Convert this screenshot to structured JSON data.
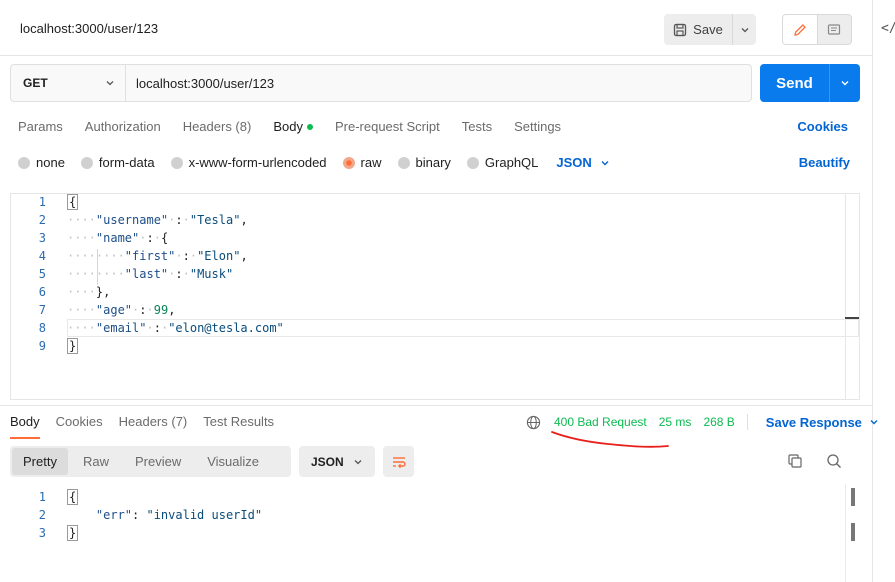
{
  "tab": {
    "title": "localhost:3000/user/123"
  },
  "toolbar": {
    "save_label": "Save"
  },
  "request": {
    "method": "GET",
    "url": "localhost:3000/user/123",
    "send_label": "Send"
  },
  "req_tabs": {
    "params": "Params",
    "authorization": "Authorization",
    "headers": "Headers (8)",
    "body": "Body",
    "prerequest": "Pre-request Script",
    "tests": "Tests",
    "settings": "Settings",
    "cookies": "Cookies"
  },
  "body_types": {
    "none": "none",
    "form_data": "form-data",
    "urlencoded": "x-www-form-urlencoded",
    "raw": "raw",
    "binary": "binary",
    "graphql": "GraphQL",
    "format": "JSON",
    "beautify": "Beautify"
  },
  "editor": {
    "line_numbers": [
      "1",
      "2",
      "3",
      "4",
      "5",
      "6",
      "7",
      "8",
      "9"
    ],
    "l1": "{",
    "l2_key": "\"username\"",
    "l2_val": "\"Tesla\"",
    "l3_key": "\"name\"",
    "l4_key": "\"first\"",
    "l4_val": "\"Elon\"",
    "l5_key": "\"last\"",
    "l5_val": "\"Musk\"",
    "l6": "},",
    "l7_key": "\"age\"",
    "l7_val": "99",
    "l8_key": "\"email\"",
    "l8_val": "\"elon@tesla.com\"",
    "l9": "}"
  },
  "response": {
    "tabs": {
      "body": "Body",
      "cookies": "Cookies",
      "headers": "Headers (7)",
      "test_results": "Test Results"
    },
    "status": "400 Bad Request",
    "time": "25 ms",
    "size": "268 B",
    "save_response": "Save Response",
    "views": {
      "pretty": "Pretty",
      "raw": "Raw",
      "preview": "Preview",
      "visualize": "Visualize"
    },
    "format": "JSON",
    "line_numbers": [
      "1",
      "2",
      "3"
    ],
    "l1": "{",
    "l2_key": "\"err\"",
    "l2_val": "\"invalid userId\"",
    "l3": "}"
  },
  "colors": {
    "accent_blue": "#097bed",
    "link_blue": "#0265d2",
    "status_green": "#0cbb52",
    "active_orange": "#ff6c37",
    "annotation_red": "#e8201c"
  }
}
